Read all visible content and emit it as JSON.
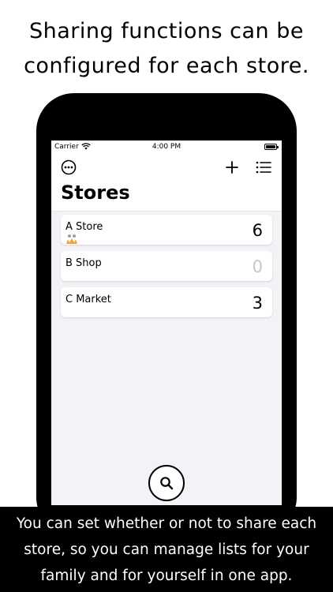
{
  "headline": {
    "line1": "Sharing functions can be",
    "line2": "configured for each store."
  },
  "status_bar": {
    "carrier": "Carrier",
    "time": "4:00 PM"
  },
  "nav": {
    "title": "Stores",
    "icons": [
      "more-icon",
      "add-icon",
      "list-icon"
    ]
  },
  "stores": [
    {
      "name": "A Store",
      "count": "6",
      "shared": true
    },
    {
      "name": "B Shop",
      "count": "0",
      "shared": false
    },
    {
      "name": "C Market",
      "count": "3",
      "shared": false
    }
  ],
  "colors": {
    "background": "#f2f2f7",
    "zero_count": "#c7c7cc",
    "shared_icon": "#f2a33a"
  },
  "caption": {
    "line1": "You can set whether or not to share each",
    "line2": "store, so you can manage lists for your",
    "line3": "family and for yourself in one app."
  }
}
